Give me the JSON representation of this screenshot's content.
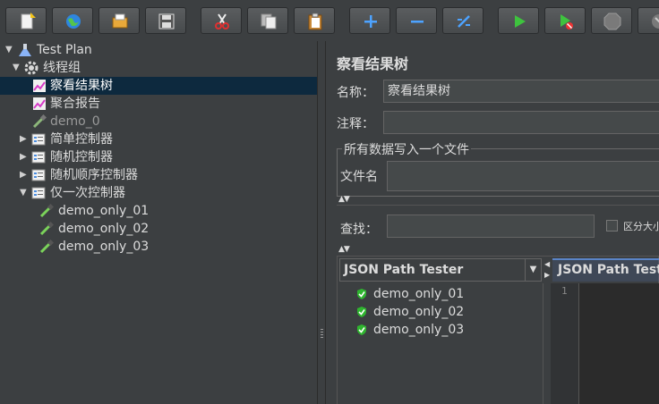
{
  "toolbar": {
    "buttons": [
      "new-icon",
      "templates-icon",
      "open-icon",
      "save-icon",
      "cut-icon",
      "copy-icon",
      "paste-icon",
      "expand-icon",
      "collapse-icon",
      "toggle-icon",
      "start-icon",
      "start-no-pause-icon",
      "stop-icon",
      "shutdown-icon"
    ]
  },
  "tree": {
    "items": [
      {
        "label": "Test Plan"
      },
      {
        "label": "线程组"
      },
      {
        "label": "察看结果树"
      },
      {
        "label": "聚合报告"
      },
      {
        "label": "demo_0"
      },
      {
        "label": "简单控制器"
      },
      {
        "label": "随机控制器"
      },
      {
        "label": "随机顺序控制器"
      },
      {
        "label": "仅一次控制器"
      },
      {
        "label": "demo_only_01"
      },
      {
        "label": "demo_only_02"
      },
      {
        "label": "demo_only_03"
      }
    ]
  },
  "panel": {
    "title": "察看结果树",
    "name_label": "名称：",
    "name_value": "察看结果树",
    "comment_label": "注释：",
    "comment_value": "",
    "group_title": "所有数据写入一个文件",
    "filename_label": "文件名",
    "filename_value": "",
    "search_label": "查找：",
    "search_value": "",
    "case_label": "区分大小"
  },
  "results": {
    "renderer": "JSON Path Tester",
    "tab": "JSON Path Tester",
    "items": [
      "demo_only_01",
      "demo_only_02",
      "demo_only_03"
    ],
    "line_number": "1"
  }
}
